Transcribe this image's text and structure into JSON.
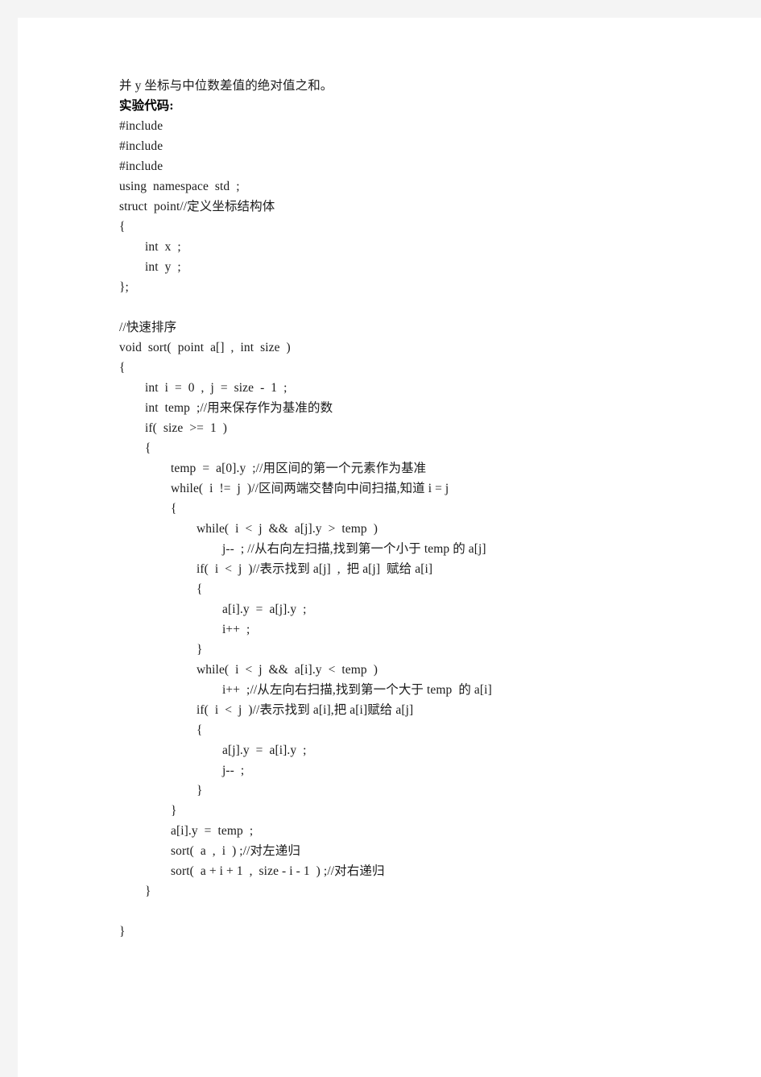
{
  "page": {
    "background_color": "#f4f4f4",
    "sheet_color": "#ffffff",
    "text_color": "#1b1b1b",
    "heading_color": "#000000"
  },
  "document": {
    "intro_line": "并 y 坐标与中位数差值的绝对值之和。",
    "section_heading": "实验代码:",
    "lines": [
      {
        "text": "#include",
        "indent": 0,
        "bold": false
      },
      {
        "text": "#include",
        "indent": 0,
        "bold": false
      },
      {
        "text": "#include",
        "indent": 0,
        "bold": false
      },
      {
        "text": "using  namespace  std  ;",
        "indent": 0,
        "bold": false
      },
      {
        "text": "struct  point//定义坐标结构体",
        "indent": 0,
        "bold": false
      },
      {
        "text": "{",
        "indent": 0,
        "bold": false
      },
      {
        "text": "int  x  ;",
        "indent": 1,
        "bold": false
      },
      {
        "text": "int  y  ;",
        "indent": 1,
        "bold": false
      },
      {
        "text": "};",
        "indent": 0,
        "bold": false
      },
      {
        "text": "",
        "indent": 0,
        "bold": false
      },
      {
        "text": "//快速排序",
        "indent": 0,
        "bold": false
      },
      {
        "text": "void  sort(  point  a[]  ,  int  size  )",
        "indent": 0,
        "bold": false
      },
      {
        "text": "{",
        "indent": 0,
        "bold": false
      },
      {
        "text": "int  i  =  0  ,  j  =  size  -  1  ;",
        "indent": 1,
        "bold": false
      },
      {
        "text": "int  temp  ;//用来保存作为基准的数",
        "indent": 1,
        "bold": false
      },
      {
        "text": "if(  size  >=  1  )",
        "indent": 1,
        "bold": false
      },
      {
        "text": "{",
        "indent": 1,
        "bold": false
      },
      {
        "text": "temp  =  a[0].y  ;//用区间的第一个元素作为基准",
        "indent": 2,
        "bold": false
      },
      {
        "text": "while(  i  !=  j  )//区间两端交替向中间扫描,知道 i = j",
        "indent": 2,
        "bold": false
      },
      {
        "text": "{",
        "indent": 2,
        "bold": false
      },
      {
        "text": "while(  i  <  j  &&  a[j].y  >  temp  )",
        "indent": 3,
        "bold": false
      },
      {
        "text": "j--  ; //从右向左扫描,找到第一个小于 temp 的 a[j]",
        "indent": 4,
        "bold": false
      },
      {
        "text": "if(  i  <  j  )//表示找到 a[j]  ,  把 a[j]  赋给 a[i]",
        "indent": 3,
        "bold": false
      },
      {
        "text": "{",
        "indent": 3,
        "bold": false
      },
      {
        "text": "a[i].y  =  a[j].y  ;",
        "indent": 4,
        "bold": false
      },
      {
        "text": "i++  ;",
        "indent": 4,
        "bold": false
      },
      {
        "text": "}",
        "indent": 3,
        "bold": false
      },
      {
        "text": "while(  i  <  j  &&  a[i].y  <  temp  )",
        "indent": 3,
        "bold": false
      },
      {
        "text": "i++  ;//从左向右扫描,找到第一个大于 temp  的 a[i]",
        "indent": 4,
        "bold": false
      },
      {
        "text": "if(  i  <  j  )//表示找到 a[i],把 a[i]赋给 a[j]",
        "indent": 3,
        "bold": false
      },
      {
        "text": "{",
        "indent": 3,
        "bold": false
      },
      {
        "text": "a[j].y  =  a[i].y  ;",
        "indent": 4,
        "bold": false
      },
      {
        "text": "j--  ;",
        "indent": 4,
        "bold": false
      },
      {
        "text": "}",
        "indent": 3,
        "bold": false
      },
      {
        "text": "}",
        "indent": 2,
        "bold": false
      },
      {
        "text": "a[i].y  =  temp  ;",
        "indent": 2,
        "bold": false
      },
      {
        "text": "sort(  a  ,  i  ) ;//对左递归",
        "indent": 2,
        "bold": false
      },
      {
        "text": "sort(  a + i + 1  ,  size - i - 1  ) ;//对右递归",
        "indent": 2,
        "bold": false
      },
      {
        "text": "}",
        "indent": 1,
        "bold": false
      },
      {
        "text": "",
        "indent": 0,
        "bold": false
      },
      {
        "text": "}",
        "indent": 0,
        "bold": false
      }
    ]
  }
}
